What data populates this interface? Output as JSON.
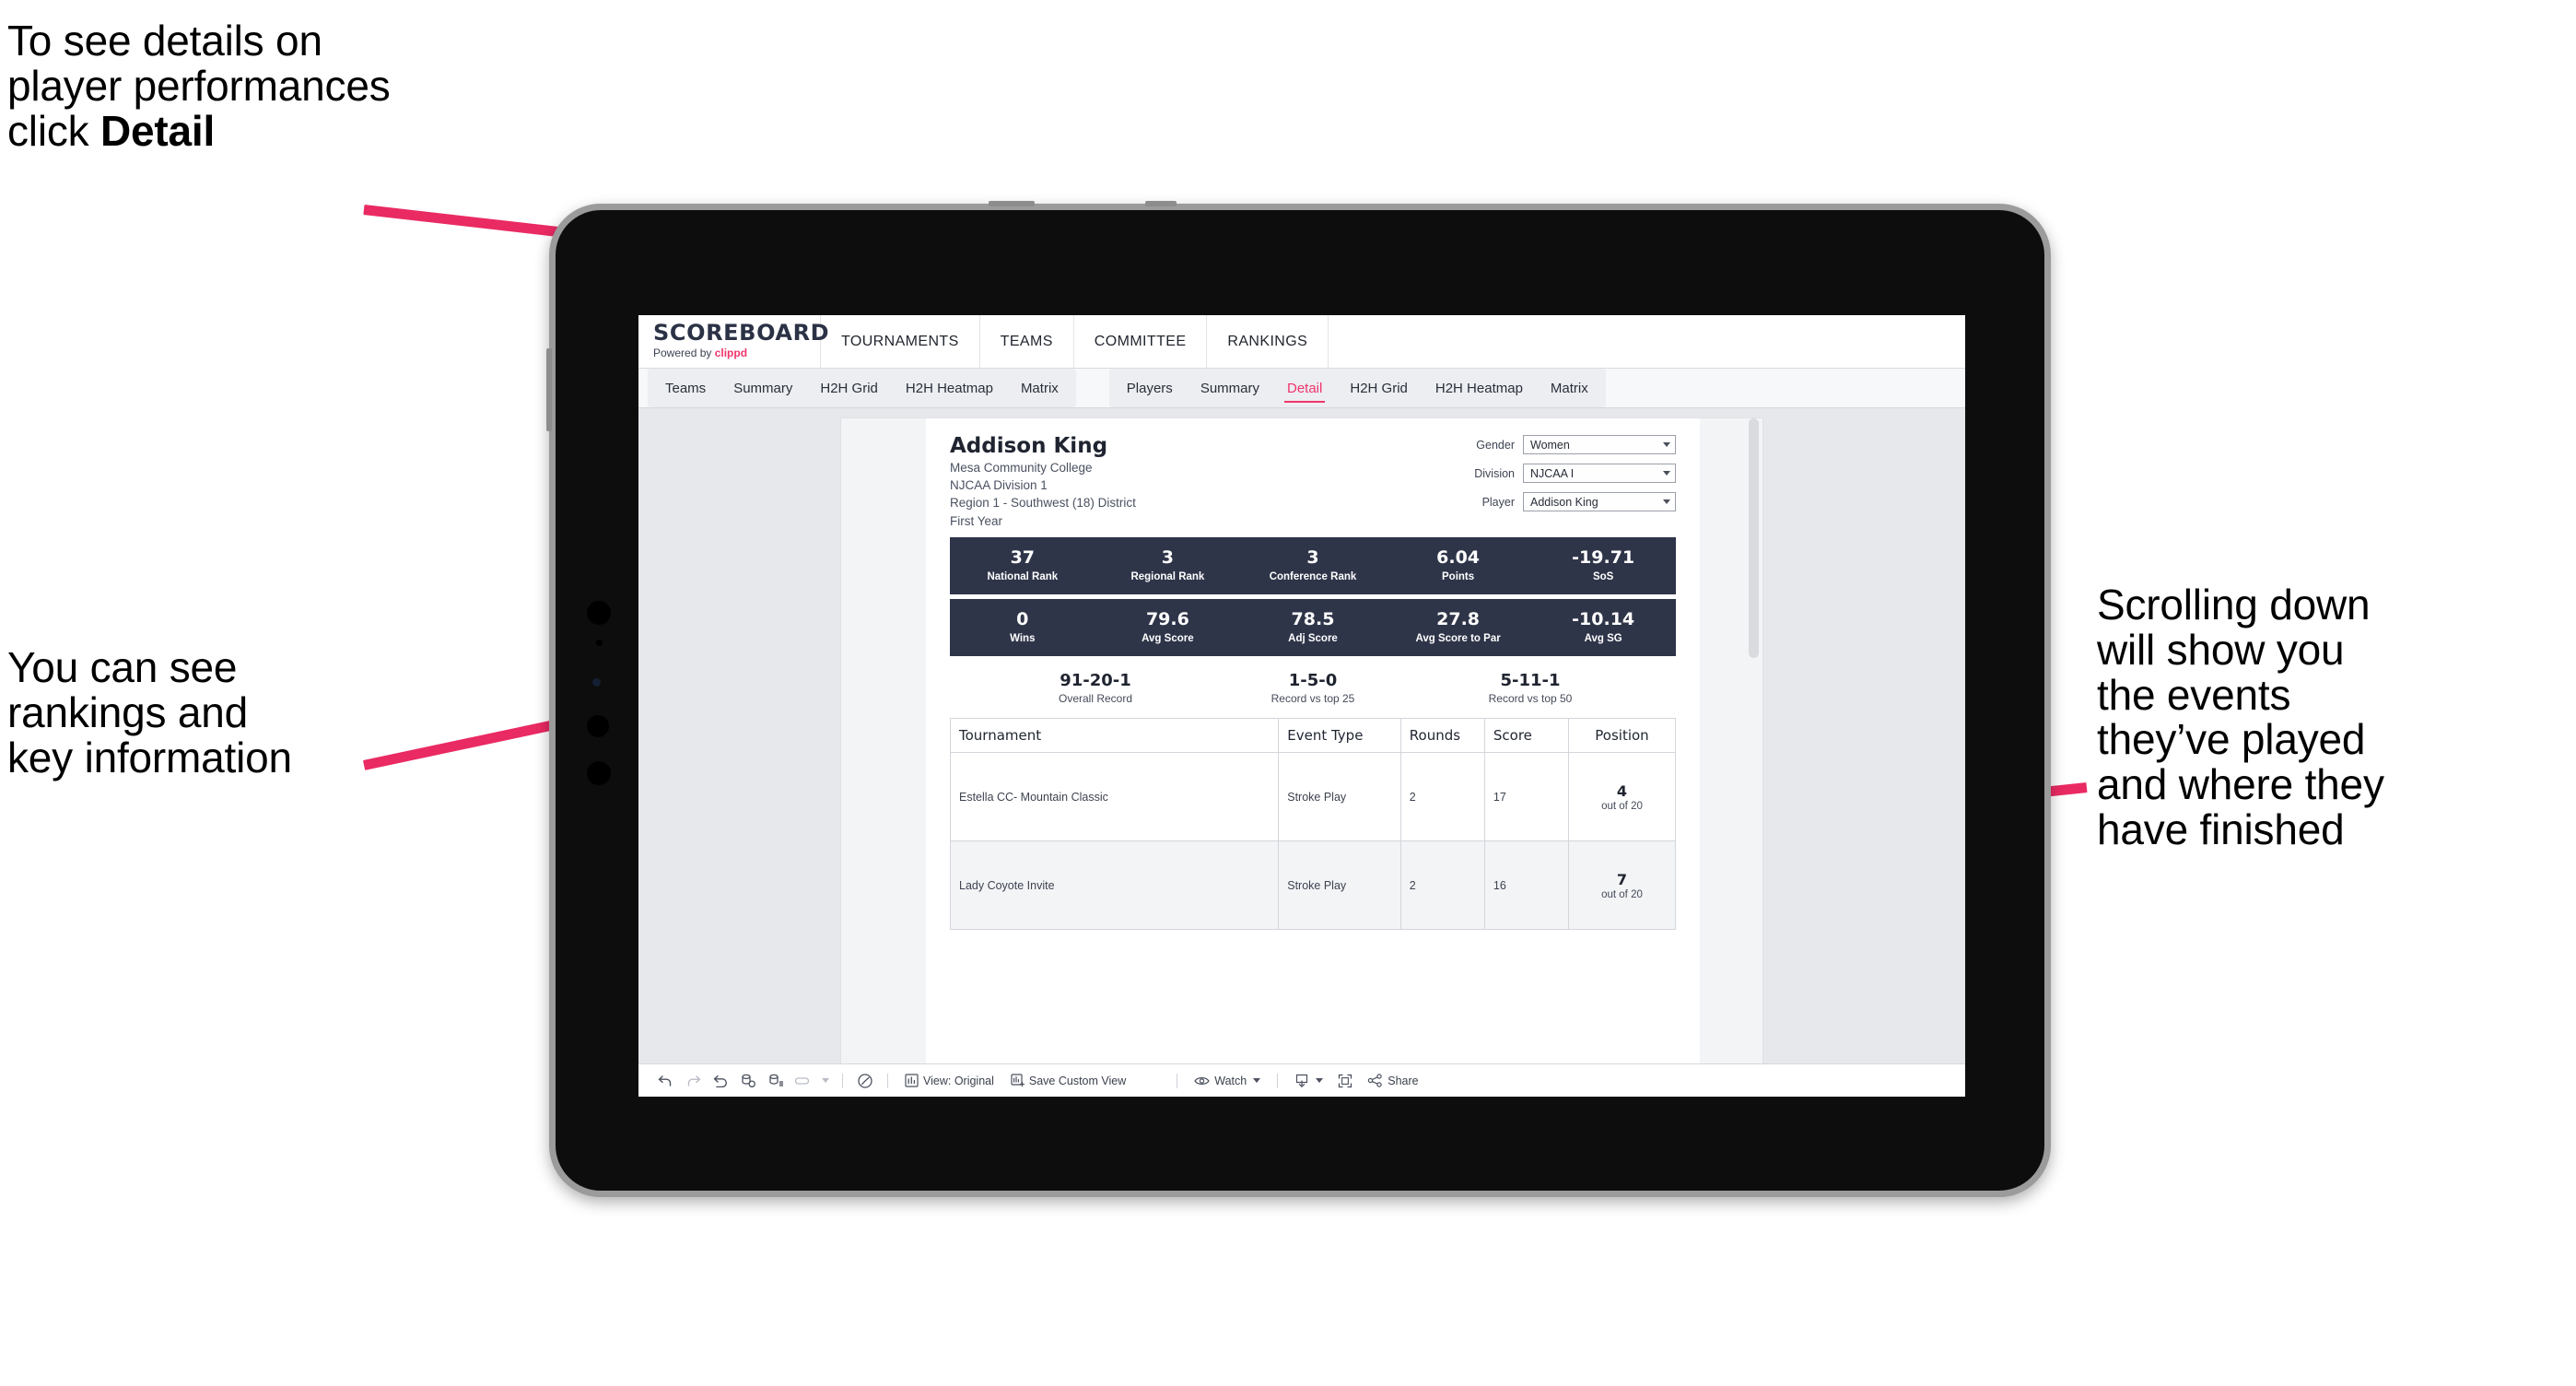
{
  "annotations": {
    "top_left": {
      "text_before": "To see details on\nplayer performances\nclick ",
      "bold": "Detail"
    },
    "bottom_left": {
      "text": "You can see\nrankings and\nkey information"
    },
    "right": {
      "text": "Scrolling down\nwill show you\nthe events\nthey’ve played\nand where they\nhave finished"
    }
  },
  "app": {
    "logo": {
      "word": "SCOREBOARD",
      "powered_prefix": "Powered by ",
      "brand": "clippd"
    },
    "topnav": [
      "TOURNAMENTS",
      "TEAMS",
      "COMMITTEE",
      "RANKINGS"
    ],
    "tabs_teams": [
      "Teams",
      "Summary",
      "H2H Grid",
      "H2H Heatmap",
      "Matrix"
    ],
    "tabs_players": [
      "Players",
      "Summary",
      "Detail",
      "H2H Grid",
      "H2H Heatmap",
      "Matrix"
    ],
    "active_tab": "Detail"
  },
  "player": {
    "name": "Addison King",
    "school": "Mesa Community College",
    "division": "NJCAA Division 1",
    "region": "Region 1 - Southwest (18) District",
    "year": "First Year"
  },
  "selectors": [
    {
      "label": "Gender",
      "value": "Women"
    },
    {
      "label": "Division",
      "value": "NJCAA I"
    },
    {
      "label": "Player",
      "value": "Addison King"
    }
  ],
  "stats_row1": [
    {
      "value": "37",
      "label": "National Rank"
    },
    {
      "value": "3",
      "label": "Regional Rank"
    },
    {
      "value": "3",
      "label": "Conference Rank"
    },
    {
      "value": "6.04",
      "label": "Points"
    },
    {
      "value": "-19.71",
      "label": "SoS"
    }
  ],
  "stats_row2": [
    {
      "value": "0",
      "label": "Wins"
    },
    {
      "value": "79.6",
      "label": "Avg Score"
    },
    {
      "value": "78.5",
      "label": "Adj Score"
    },
    {
      "value": "27.8",
      "label": "Avg Score to Par"
    },
    {
      "value": "-10.14",
      "label": "Avg SG"
    }
  ],
  "records": [
    {
      "value": "91-20-1",
      "label": "Overall Record"
    },
    {
      "value": "1-5-0",
      "label": "Record vs top 25"
    },
    {
      "value": "5-11-1",
      "label": "Record vs top 50"
    }
  ],
  "table": {
    "headers": [
      "Tournament",
      "Event Type",
      "Rounds",
      "Score",
      "Position"
    ],
    "rows": [
      {
        "tournament": "Estella CC- Mountain Classic",
        "event_type": "Stroke Play",
        "rounds": "2",
        "score": "17",
        "position": "4",
        "position_sub": "out of 20"
      },
      {
        "tournament": "Lady Coyote Invite",
        "event_type": "Stroke Play",
        "rounds": "2",
        "score": "16",
        "position": "7",
        "position_sub": "out of 20"
      }
    ]
  },
  "toolbar": {
    "view_label": "View: Original",
    "save_label": "Save Custom View",
    "watch_label": "Watch",
    "share_label": "Share"
  },
  "colors": {
    "accent": "#f0356c",
    "arrow": "#ea2a63",
    "band": "#2f3549",
    "screen_bg": "#e6e8ec"
  }
}
